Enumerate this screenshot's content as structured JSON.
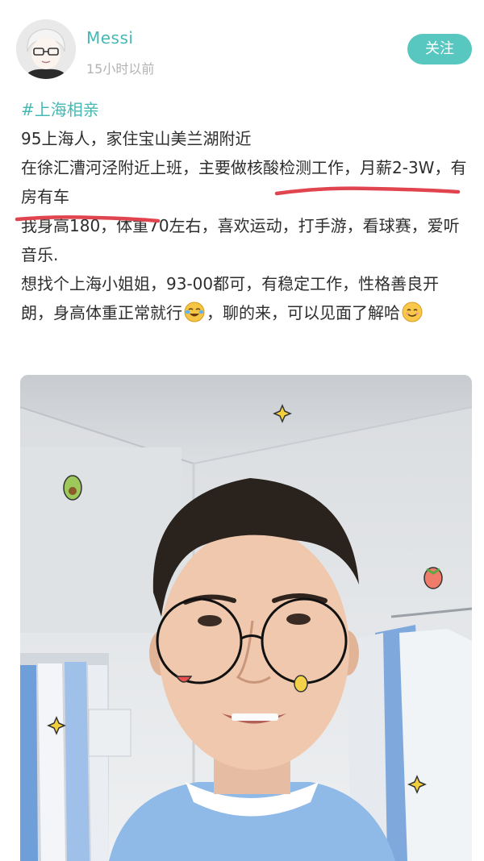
{
  "user": {
    "name": "Messi",
    "timestamp": "15小时以前",
    "follow_label": "关注"
  },
  "post": {
    "hashtag": "#上海相亲",
    "line1": "95上海人，家住宝山美兰湖附近",
    "line2": "在徐汇漕河泾附近上班，主要做核酸检测工作，月薪2-3W，有房有车",
    "line3": "我身高180，体重70左右，喜欢运动，打手游，看球赛，爱听音乐.",
    "line4_part1": "想找个上海小姐姐，93-00都可，有稳定工作，性格善良开朗，身高体重正常就行",
    "line4_part2": "，聊的来，可以见面了解哈"
  },
  "icons": {
    "crying_laughing": "face-with-tears-of-joy-icon",
    "smile": "smiling-face-icon"
  },
  "colors": {
    "accent": "#46b8b3",
    "follow_button": "#57c7bf",
    "underline": "#e0454f",
    "text": "#2e2e2e",
    "muted": "#b3b3b3"
  }
}
